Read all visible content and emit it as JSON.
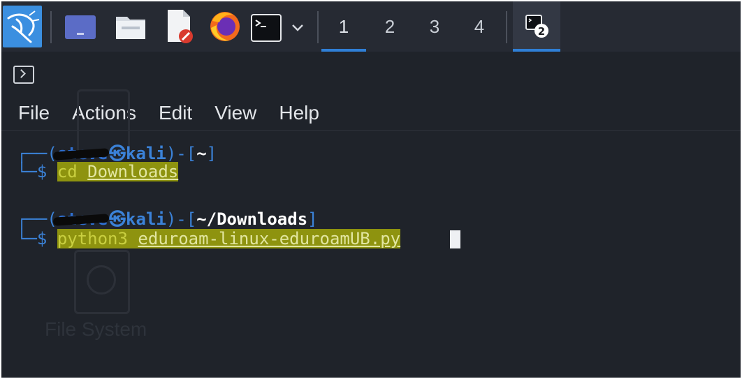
{
  "taskbar": {
    "workspaces": [
      "1",
      "2",
      "3",
      "4"
    ],
    "active_workspace": "1",
    "terminal_task_badge": "2",
    "colors": {
      "accent": "#2f7fd6",
      "panel": "#262a33"
    },
    "icons": [
      "kali-dragon-icon",
      "desktop-icon",
      "folder-icon",
      "text-editor-icon",
      "firefox-icon",
      "terminal-icon",
      "chevron-down-icon"
    ]
  },
  "window": {
    "menu": [
      "File",
      "Actions",
      "Edit",
      "View",
      "Help"
    ]
  },
  "terminal": {
    "prompts": [
      {
        "user": "steve",
        "at": "㉿",
        "host": "kali",
        "path": "~",
        "command": "cd",
        "argument": "Downloads"
      },
      {
        "user": "steve",
        "at": "㉿",
        "host": "kali",
        "path": "~/Downloads",
        "command": "python3",
        "argument": "eduroam-linux-eduroamUB.py"
      }
    ],
    "prompt_symbol": "$"
  },
  "desktop_ghost": {
    "label": "File System"
  }
}
